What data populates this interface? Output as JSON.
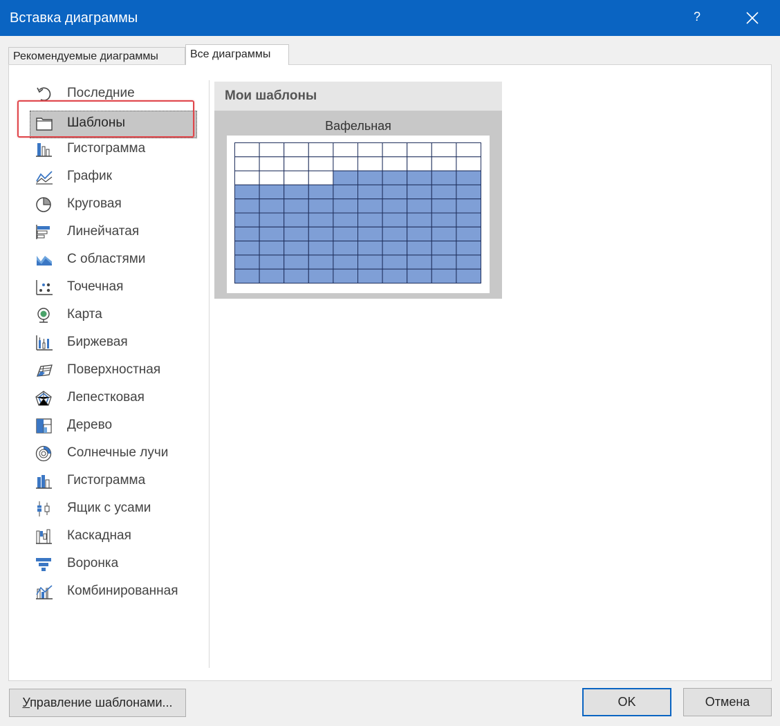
{
  "window": {
    "title": "Вставка диаграммы",
    "help_label": "?",
    "accent_color": "#0a64c2"
  },
  "tabs": [
    {
      "label": "Рекомендуемые диаграммы",
      "active": false
    },
    {
      "label": "Все диаграммы",
      "active": true
    }
  ],
  "sidebar": {
    "items": [
      {
        "label": "Последние",
        "icon": "recent-icon"
      },
      {
        "label": "Шаблоны",
        "icon": "templates-folder-icon",
        "selected": true
      },
      {
        "label": "Гистограмма",
        "icon": "column-chart-icon"
      },
      {
        "label": "График",
        "icon": "line-chart-icon"
      },
      {
        "label": "Круговая",
        "icon": "pie-chart-icon"
      },
      {
        "label": "Линейчатая",
        "icon": "bar-chart-icon"
      },
      {
        "label": "С областями",
        "icon": "area-chart-icon"
      },
      {
        "label": "Точечная",
        "icon": "scatter-chart-icon"
      },
      {
        "label": "Карта",
        "icon": "map-chart-icon"
      },
      {
        "label": "Биржевая",
        "icon": "stock-chart-icon"
      },
      {
        "label": "Поверхностная",
        "icon": "surface-chart-icon"
      },
      {
        "label": "Лепестковая",
        "icon": "radar-chart-icon"
      },
      {
        "label": "Дерево",
        "icon": "treemap-chart-icon"
      },
      {
        "label": "Солнечные лучи",
        "icon": "sunburst-chart-icon"
      },
      {
        "label": "Гистограмма",
        "icon": "histogram-chart-icon"
      },
      {
        "label": "Ящик с усами",
        "icon": "box-whisker-chart-icon"
      },
      {
        "label": "Каскадная",
        "icon": "waterfall-chart-icon"
      },
      {
        "label": "Воронка",
        "icon": "funnel-chart-icon"
      },
      {
        "label": "Комбинированная",
        "icon": "combo-chart-icon"
      }
    ]
  },
  "content": {
    "group_title": "Мои шаблоны",
    "templates": [
      {
        "name": "Вафельная",
        "waffle": {
          "columns": 10,
          "rows": 10,
          "filled_cells": 76,
          "filled_color": "#7f9fd6",
          "empty_color": "#ffffff",
          "grid_color": "#1f2f5c"
        }
      }
    ]
  },
  "buttons": {
    "manage_prefix": "У",
    "manage_rest": "правление шаблонами...",
    "ok": "OK",
    "cancel": "Отмена"
  }
}
